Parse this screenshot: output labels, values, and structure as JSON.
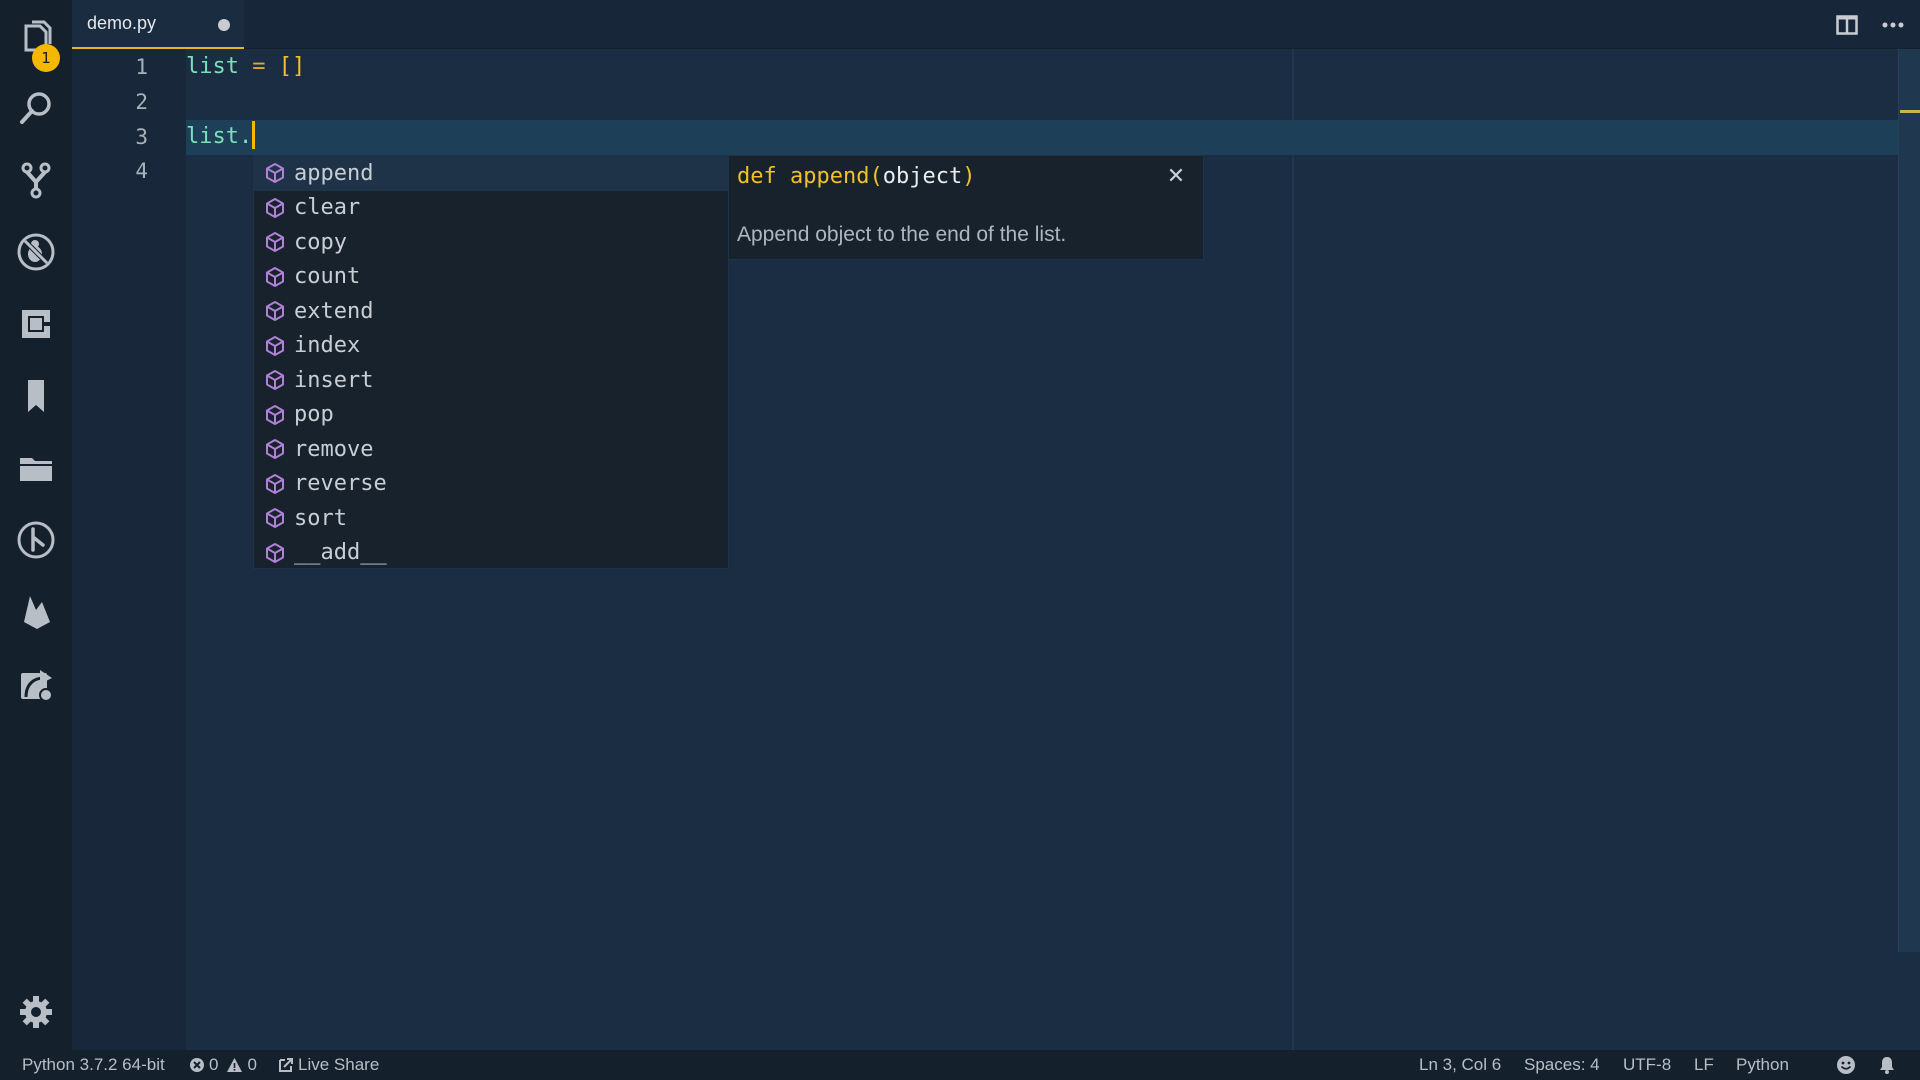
{
  "activity_bar": {
    "items": [
      {
        "name": "explorer",
        "icon": "files-icon",
        "badge": "1"
      },
      {
        "name": "search",
        "icon": "search-icon"
      },
      {
        "name": "source-control",
        "icon": "source-control-icon"
      },
      {
        "name": "debug",
        "icon": "debug-disabled-icon"
      },
      {
        "name": "extensions",
        "icon": "extensions-icon"
      },
      {
        "name": "bookmarks",
        "icon": "bookmark-icon"
      },
      {
        "name": "project-manager",
        "icon": "folder-icon"
      },
      {
        "name": "gitlens",
        "icon": "git-history-icon"
      },
      {
        "name": "firebase",
        "icon": "firebase-icon"
      },
      {
        "name": "remote",
        "icon": "remote-explorer-icon"
      }
    ],
    "settings_icon": "gear-icon"
  },
  "tabs": [
    {
      "label": "demo.py",
      "dirty": true,
      "active": true
    }
  ],
  "tab_actions": {
    "split": "split-editor-icon",
    "more": "more-actions-icon"
  },
  "editor": {
    "line_numbers": [
      "1",
      "2",
      "3",
      "4"
    ],
    "lines": [
      {
        "tokens": [
          {
            "t": "list",
            "c": "ident"
          },
          {
            "t": " ",
            "c": ""
          },
          {
            "t": "=",
            "c": "op"
          },
          {
            "t": " ",
            "c": ""
          },
          {
            "t": "[]",
            "c": "brk"
          }
        ]
      },
      {
        "tokens": []
      },
      {
        "tokens": [
          {
            "t": "list",
            "c": "ident"
          },
          {
            "t": ".",
            "c": "ident"
          }
        ]
      },
      {
        "tokens": []
      }
    ],
    "current_line": 3
  },
  "suggest": {
    "items": [
      {
        "label": "append",
        "kind": "method",
        "selected": true
      },
      {
        "label": "clear",
        "kind": "method"
      },
      {
        "label": "copy",
        "kind": "method"
      },
      {
        "label": "count",
        "kind": "method"
      },
      {
        "label": "extend",
        "kind": "method"
      },
      {
        "label": "index",
        "kind": "method"
      },
      {
        "label": "insert",
        "kind": "method"
      },
      {
        "label": "pop",
        "kind": "method"
      },
      {
        "label": "remove",
        "kind": "method"
      },
      {
        "label": "reverse",
        "kind": "method"
      },
      {
        "label": "sort",
        "kind": "method"
      },
      {
        "label": "__add__",
        "kind": "method"
      }
    ],
    "details": {
      "keyword": "def",
      "function": "append",
      "open_paren": "(",
      "argument": "object",
      "close_paren": ")",
      "doc": "Append object to the end of the list.",
      "close_glyph": "✕"
    }
  },
  "statusbar": {
    "interpreter": "Python 3.7.2 64-bit",
    "errors": "0",
    "warnings": "0",
    "live_share": "Live Share",
    "position": "Ln 3, Col 6",
    "indentation": "Spaces: 4",
    "encoding": "UTF-8",
    "eol": "LF",
    "language": "Python"
  },
  "colors": {
    "accent": "#f2b900",
    "method_icon": "#b180d7"
  }
}
